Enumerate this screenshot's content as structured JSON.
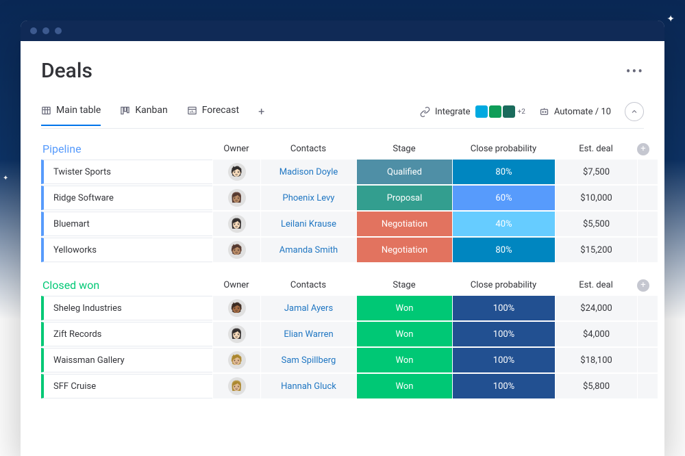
{
  "page": {
    "title": "Deals"
  },
  "tabs": [
    {
      "label": "Main table",
      "icon": "table-icon",
      "active": true
    },
    {
      "label": "Kanban",
      "icon": "kanban-icon",
      "active": false
    },
    {
      "label": "Forecast",
      "icon": "forecast-icon",
      "active": false
    }
  ],
  "toolbar": {
    "integrate": "Integrate",
    "integrate_apps": [
      "#00a9e0",
      "#0f9d58",
      "#1a6b5c"
    ],
    "integrate_more": "+2",
    "automate": "Automate / 10"
  },
  "columns": [
    "Owner",
    "Contacts",
    "Stage",
    "Close probability",
    "Est. deal"
  ],
  "groups": [
    {
      "name": "Pipeline",
      "class": "group-pipeline",
      "rows": [
        {
          "name": "Twister Sports",
          "owner_emoji": "🧑🏻",
          "contact": "Madison Doyle",
          "stage": "Qualified",
          "stage_color": "#4f8fa6",
          "prob": "80%",
          "prob_color": "#0086c0",
          "deal": "$7,500"
        },
        {
          "name": "Ridge Software",
          "owner_emoji": "👩🏽",
          "contact": "Phoenix Levy",
          "stage": "Proposal",
          "stage_color": "#339e8f",
          "prob": "60%",
          "prob_color": "#579bfc",
          "deal": "$10,000"
        },
        {
          "name": "Bluemart",
          "owner_emoji": "👩🏻",
          "contact": "Leilani Krause",
          "stage": "Negotiation",
          "stage_color": "#e2735f",
          "prob": "40%",
          "prob_color": "#66ccff",
          "deal": "$5,500"
        },
        {
          "name": "Yelloworks",
          "owner_emoji": "🧑🏽",
          "contact": "Amanda Smith",
          "stage": "Negotiation",
          "stage_color": "#e2735f",
          "prob": "80%",
          "prob_color": "#0086c0",
          "deal": "$15,200"
        }
      ]
    },
    {
      "name": "Closed won",
      "class": "group-closed",
      "rows": [
        {
          "name": "Sheleg Industries",
          "owner_emoji": "🧑🏾",
          "contact": "Jamal Ayers",
          "stage": "Won",
          "stage_color": "#00c875",
          "prob": "100%",
          "prob_color": "#225091",
          "deal": "$24,000"
        },
        {
          "name": "Zift Records",
          "owner_emoji": "👩🏻",
          "contact": "Elian Warren",
          "stage": "Won",
          "stage_color": "#00c875",
          "prob": "100%",
          "prob_color": "#225091",
          "deal": "$4,000"
        },
        {
          "name": "Waissman Gallery",
          "owner_emoji": "🧑🏼",
          "contact": "Sam Spillberg",
          "stage": "Won",
          "stage_color": "#00c875",
          "prob": "100%",
          "prob_color": "#225091",
          "deal": "$18,100"
        },
        {
          "name": "SFF Cruise",
          "owner_emoji": "👩🏼",
          "contact": "Hannah Gluck",
          "stage": "Won",
          "stage_color": "#00c875",
          "prob": "100%",
          "prob_color": "#225091",
          "deal": "$5,800"
        }
      ]
    }
  ]
}
